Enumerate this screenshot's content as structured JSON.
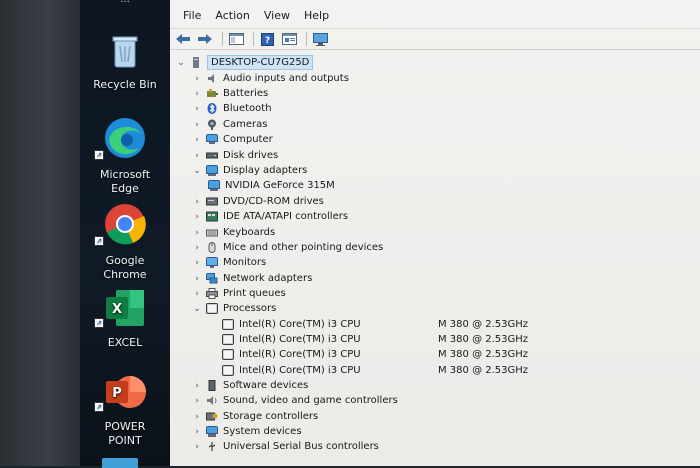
{
  "desktop": {
    "top_partial_label": "...",
    "icons": [
      {
        "label": "Recycle Bin",
        "icon": "recycle-bin-icon"
      },
      {
        "label": "Microsoft Edge",
        "icon": "edge-icon"
      },
      {
        "label": "Google Chrome",
        "icon": "chrome-icon"
      },
      {
        "label": "EXCEL",
        "icon": "excel-icon"
      },
      {
        "label": "POWER POINT",
        "icon": "powerpoint-icon"
      }
    ]
  },
  "menubar": {
    "file": "File",
    "action": "Action",
    "view": "View",
    "help": "Help"
  },
  "toolbar": {
    "buttons": [
      "back-arrow-icon",
      "forward-arrow-icon",
      "show-hide-tree-icon",
      "help-icon",
      "properties-icon",
      "monitor-scan-icon"
    ]
  },
  "tree": {
    "root": "DESKTOP-CU7G25D",
    "categories": [
      {
        "label": "Audio inputs and outputs",
        "icon": "speaker-icon"
      },
      {
        "label": "Batteries",
        "icon": "battery-icon"
      },
      {
        "label": "Bluetooth",
        "icon": "bluetooth-icon"
      },
      {
        "label": "Cameras",
        "icon": "camera-icon"
      },
      {
        "label": "Computer",
        "icon": "computer-icon"
      },
      {
        "label": "Disk drives",
        "icon": "disk-drive-icon"
      },
      {
        "label": "Display adapters",
        "icon": "display-adapter-icon"
      },
      {
        "label": "DVD/CD-ROM drives",
        "icon": "dvd-drive-icon"
      },
      {
        "label": "IDE ATA/ATAPI controllers",
        "icon": "ide-controller-icon"
      },
      {
        "label": "Keyboards",
        "icon": "keyboard-icon"
      },
      {
        "label": "Mice and other pointing devices",
        "icon": "mouse-icon"
      },
      {
        "label": "Monitors",
        "icon": "monitor-icon"
      },
      {
        "label": "Network adapters",
        "icon": "network-adapter-icon"
      },
      {
        "label": "Print queues",
        "icon": "printer-icon"
      },
      {
        "label": "Processors",
        "icon": "processor-icon"
      },
      {
        "label": "Software devices",
        "icon": "software-device-icon"
      },
      {
        "label": "Sound, video and game controllers",
        "icon": "sound-icon"
      },
      {
        "label": "Storage controllers",
        "icon": "storage-controller-icon"
      },
      {
        "label": "System devices",
        "icon": "system-device-icon"
      },
      {
        "label": "Universal Serial Bus controllers",
        "icon": "usb-icon"
      }
    ],
    "display_adapter": "NVIDIA GeForce 315M",
    "processors": [
      {
        "model": "Intel(R) Core(TM) i3 CPU",
        "speed": "M 380  @ 2.53GHz"
      },
      {
        "model": "Intel(R) Core(TM) i3 CPU",
        "speed": "M 380  @ 2.53GHz"
      },
      {
        "model": "Intel(R) Core(TM) i3 CPU",
        "speed": "M 380  @ 2.53GHz"
      },
      {
        "model": "Intel(R) Core(TM) i3 CPU",
        "speed": "M 380  @ 2.53GHz"
      }
    ]
  }
}
